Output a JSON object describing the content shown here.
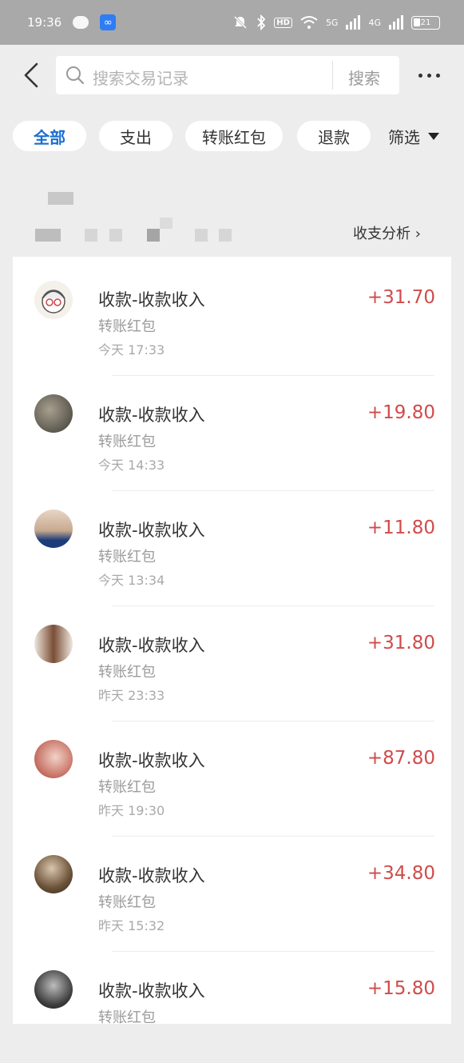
{
  "status_bar": {
    "time": "19:36",
    "battery": "21",
    "network_1": "5G",
    "network_2": "4G",
    "hd": "HD"
  },
  "header": {
    "search_placeholder": "搜索交易记录",
    "search_button": "搜索"
  },
  "filters": {
    "chips": [
      "全部",
      "支出",
      "转账红包",
      "退款"
    ],
    "filter_label": "筛选"
  },
  "summary": {
    "analysis_link": "收支分析 ›"
  },
  "transactions": [
    {
      "title": "收款-收款收入",
      "category": "转账红包",
      "time": "今天 17:33",
      "amount": "+31.70"
    },
    {
      "title": "收款-收款收入",
      "category": "转账红包",
      "time": "今天 14:33",
      "amount": "+19.80"
    },
    {
      "title": "收款-收款收入",
      "category": "转账红包",
      "time": "今天 13:34",
      "amount": "+11.80"
    },
    {
      "title": "收款-收款收入",
      "category": "转账红包",
      "time": "昨天 23:33",
      "amount": "+31.80"
    },
    {
      "title": "收款-收款收入",
      "category": "转账红包",
      "time": "昨天 19:30",
      "amount": "+87.80"
    },
    {
      "title": "收款-收款收入",
      "category": "转账红包",
      "time": "昨天 15:32",
      "amount": "+34.80"
    },
    {
      "title": "收款-收款收入",
      "category": "转账红包",
      "time": "",
      "amount": "+15.80"
    }
  ],
  "colors": {
    "accent": "#1a6fd1",
    "income": "#d04b4b",
    "background": "#ededed"
  }
}
